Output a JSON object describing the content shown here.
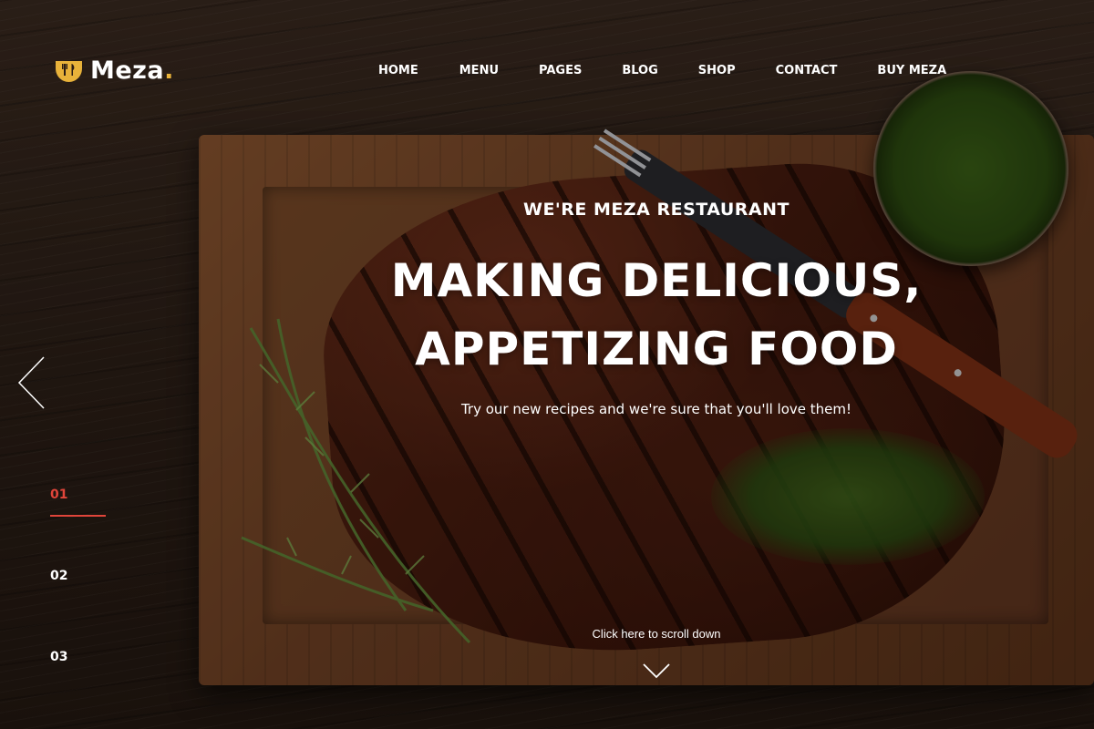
{
  "brand": {
    "name": "Meza",
    "dot": ".",
    "accent": "#e8b23a"
  },
  "nav": {
    "items": [
      {
        "label": "HOME"
      },
      {
        "label": "MENU"
      },
      {
        "label": "PAGES"
      },
      {
        "label": "BLOG"
      },
      {
        "label": "SHOP"
      },
      {
        "label": "CONTACT"
      },
      {
        "label": "BUY MEZA"
      }
    ]
  },
  "hero": {
    "eyebrow": "WE'RE MEZA RESTAURANT",
    "headline_line1": "MAKING DELICIOUS,",
    "headline_line2": "APPETIZING FOOD",
    "subline": "Try our new recipes and we're sure that you'll love them!"
  },
  "slider": {
    "slides": [
      "01",
      "02",
      "03"
    ],
    "active_index": 0,
    "active_color": "#e0453a",
    "prev_icon": "chevron-left-icon"
  },
  "scroll": {
    "label": "Click here to scroll down",
    "icon": "chevron-down-icon"
  }
}
